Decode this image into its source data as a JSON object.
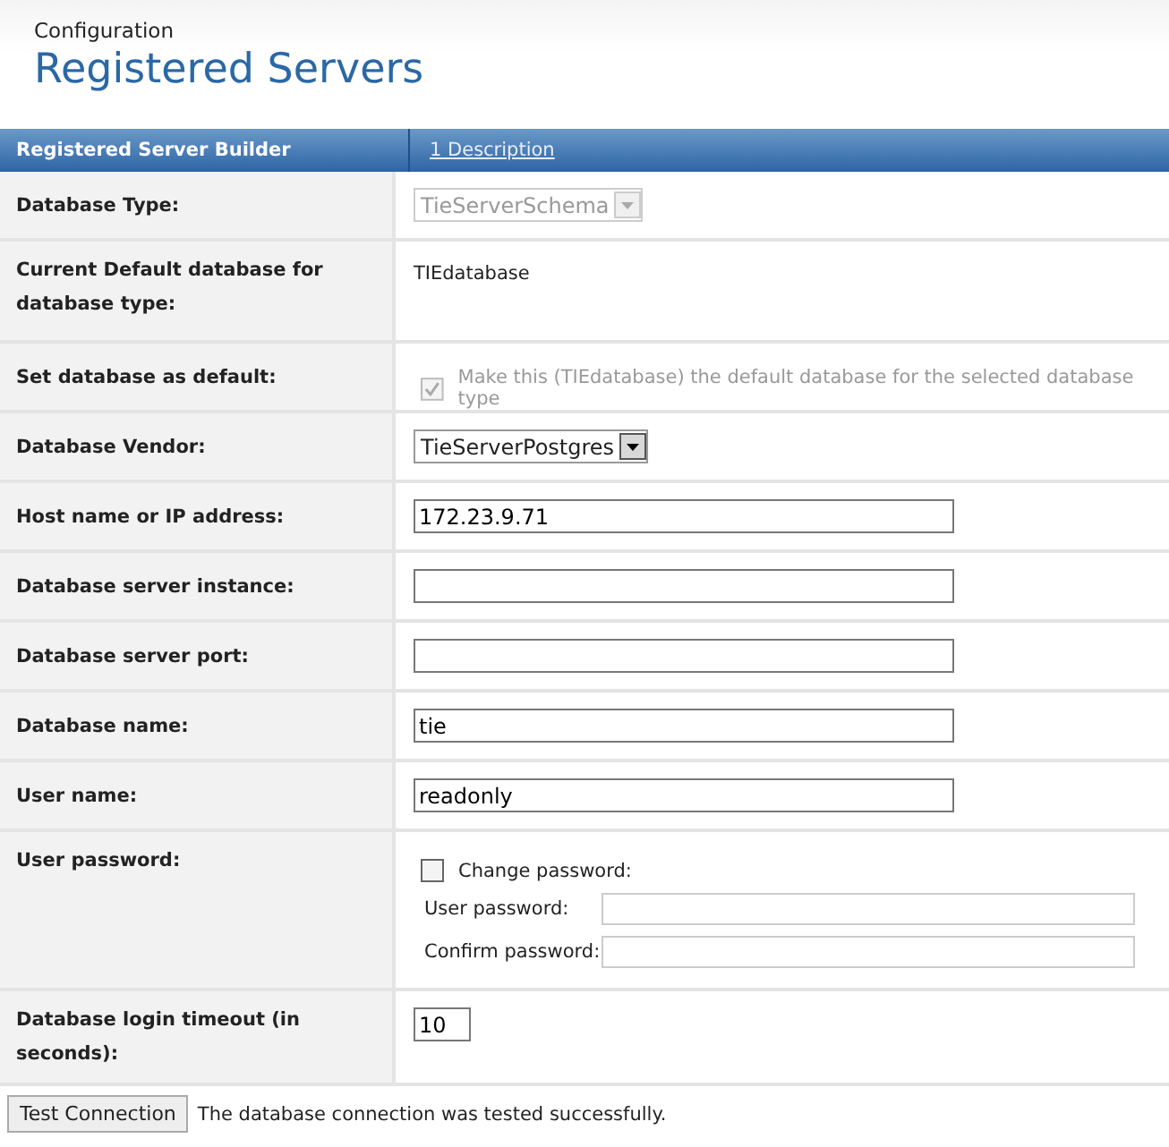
{
  "breadcrumb": "Configuration",
  "title": "Registered Servers",
  "header": {
    "left": "Registered Server Builder",
    "link": "1 Description"
  },
  "rows": [
    {
      "kind": "select",
      "label": "Database Type:",
      "value": "TieServerSchema",
      "disabled": true
    },
    {
      "kind": "text",
      "label": "Current Default database for database type:",
      "value": "TIEdatabase"
    },
    {
      "kind": "checkbox",
      "label": "Set database as default:",
      "text": "Make this (TIEdatabase) the default database for the selected database type",
      "checked": true,
      "disabled": true
    },
    {
      "kind": "select",
      "label": "Database Vendor:",
      "value": "TieServerPostgres",
      "disabled": false
    },
    {
      "kind": "input",
      "label": "Host name or IP address:",
      "value": "172.23.9.71"
    },
    {
      "kind": "input",
      "label": "Database server instance:"
    },
    {
      "kind": "input",
      "label": "Database server port:"
    },
    {
      "kind": "input",
      "label": "Database name:",
      "value": "tie"
    },
    {
      "kind": "input",
      "label": "User name:",
      "value": "readonly"
    },
    {
      "kind": "password",
      "label": "User password:",
      "text": "Change password:",
      "checked": false,
      "fields": [
        "User password:",
        "Confirm password:"
      ]
    },
    {
      "kind": "short",
      "label": "Database login timeout (in seconds):",
      "value": "10"
    }
  ],
  "footer": {
    "button": "Test Connection",
    "message": "The database connection was tested successfully."
  }
}
